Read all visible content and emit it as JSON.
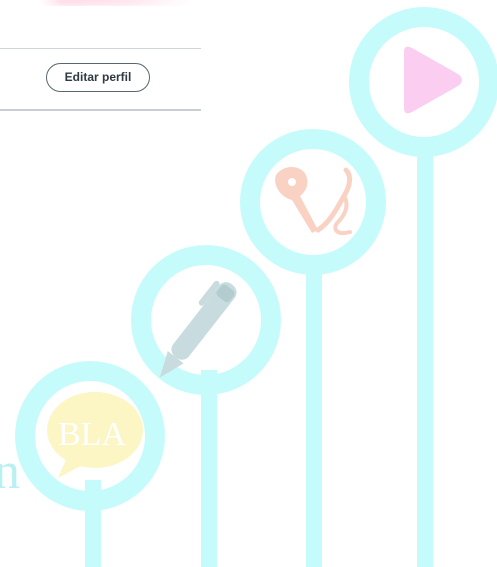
{
  "profile": {
    "edit_button_label": "Editar perfil"
  },
  "illustration": {
    "bubble_text": "BLA",
    "edge_letter": "n",
    "icons": [
      "speech-bubble-icon",
      "pen-icon",
      "fountain-pen-nib-icon",
      "play-icon"
    ],
    "colors": {
      "ring": "#c6fbfc",
      "bubble": "#fbf6c4",
      "pen": "#c8dcdf",
      "nib": "#f9d2c4",
      "play": "#fbcdf0",
      "button_border": "#5b6770",
      "button_text": "#2f3a43"
    }
  }
}
